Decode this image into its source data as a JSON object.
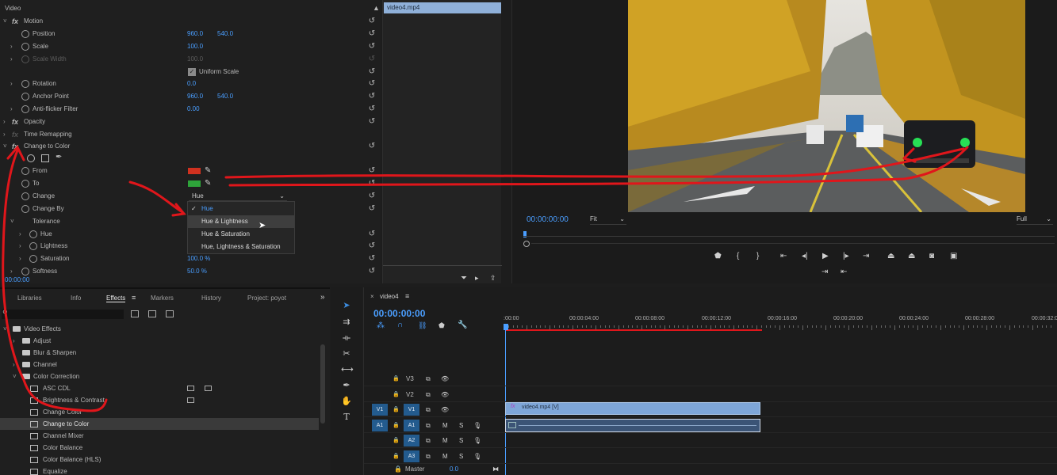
{
  "effect_controls": {
    "section": "Video",
    "motion": "Motion",
    "position": {
      "label": "Position",
      "x": "960.0",
      "y": "540.0"
    },
    "scale": {
      "label": "Scale",
      "value": "100.0"
    },
    "scale_width": {
      "label": "Scale Width",
      "value": "100.0"
    },
    "uniform_scale": "Uniform Scale",
    "rotation": {
      "label": "Rotation",
      "value": "0.0"
    },
    "anchor_point": {
      "label": "Anchor Point",
      "x": "960.0",
      "y": "540.0"
    },
    "anti_flicker": {
      "label": "Anti-flicker Filter",
      "value": "0.00"
    },
    "opacity": "Opacity",
    "time_remapping": "Time Remapping",
    "change_to_color": "Change to Color",
    "from": {
      "label": "From",
      "color": "#d0311f"
    },
    "to": {
      "label": "To",
      "color": "#2ea43a"
    },
    "change": {
      "label": "Change",
      "value": "Hue"
    },
    "change_by": "Change By",
    "tolerance": "Tolerance",
    "hue": "Hue",
    "lightness": "Lightness",
    "saturation": {
      "label": "Saturation",
      "value": "100.0 %"
    },
    "softness": {
      "label": "Softness",
      "value": "50.0 %"
    },
    "timecode": "00:00:00",
    "clip_label": "video4.mp4"
  },
  "dropdown": {
    "options": [
      "Hue",
      "Hue & Lightness",
      "Hue & Saturation",
      "Hue, Lightness & Saturation"
    ],
    "selected": "Hue",
    "hovered": "Hue & Lightness"
  },
  "program_monitor": {
    "timecode": "00:00:00:00",
    "fit": "Fit",
    "resolution": "Full"
  },
  "panels": {
    "tabs": [
      "Libraries",
      "Info",
      "Effects",
      "Markers",
      "History",
      "Project: poyot"
    ],
    "active": "Effects"
  },
  "effects_tree": [
    {
      "label": "Video Effects",
      "type": "folder",
      "indent": 0,
      "open": true
    },
    {
      "label": "Adjust",
      "type": "folder",
      "indent": 1
    },
    {
      "label": "Blur & Sharpen",
      "type": "folder",
      "indent": 1
    },
    {
      "label": "Channel",
      "type": "folder",
      "indent": 1
    },
    {
      "label": "Color Correction",
      "type": "folder",
      "indent": 1,
      "open": true
    },
    {
      "label": "ASC CDL",
      "type": "effect",
      "indent": 2
    },
    {
      "label": "Brightness & Contrast",
      "type": "effect",
      "indent": 2
    },
    {
      "label": "Change Color",
      "type": "effect",
      "indent": 2
    },
    {
      "label": "Change to Color",
      "type": "effect",
      "indent": 2,
      "selected": true
    },
    {
      "label": "Channel Mixer",
      "type": "effect",
      "indent": 2
    },
    {
      "label": "Color Balance",
      "type": "effect",
      "indent": 2
    },
    {
      "label": "Color Balance (HLS)",
      "type": "effect",
      "indent": 2
    },
    {
      "label": "Equalize",
      "type": "effect",
      "indent": 2
    }
  ],
  "timeline": {
    "sequence": "video4",
    "timecode": "00:00:00:00",
    "ruler": [
      ":00:00",
      "00:00:04:00",
      "00:00:08:00",
      "00:00:12:00",
      "00:00:16:00",
      "00:00:20:00",
      "00:00:24:00",
      "00:00:28:00",
      "00:00:32:00"
    ],
    "tracks": [
      {
        "name": "V3",
        "kind": "video"
      },
      {
        "name": "V2",
        "kind": "video"
      },
      {
        "name": "V1",
        "kind": "video",
        "source": "V1"
      },
      {
        "name": "A1",
        "kind": "audio",
        "source": "A1"
      },
      {
        "name": "A2",
        "kind": "audio"
      },
      {
        "name": "A3",
        "kind": "audio"
      }
    ],
    "video_clip": "video4.mp4 [V]",
    "master": {
      "label": "Master",
      "value": "0.0"
    },
    "audio_ms": {
      "m": "M",
      "s": "S"
    }
  },
  "colors": {
    "accent_blue": "#4a9eff",
    "annotation_red": "#e0161b",
    "clip_blue": "#7ea6d8",
    "track_blue": "#235b8e"
  }
}
